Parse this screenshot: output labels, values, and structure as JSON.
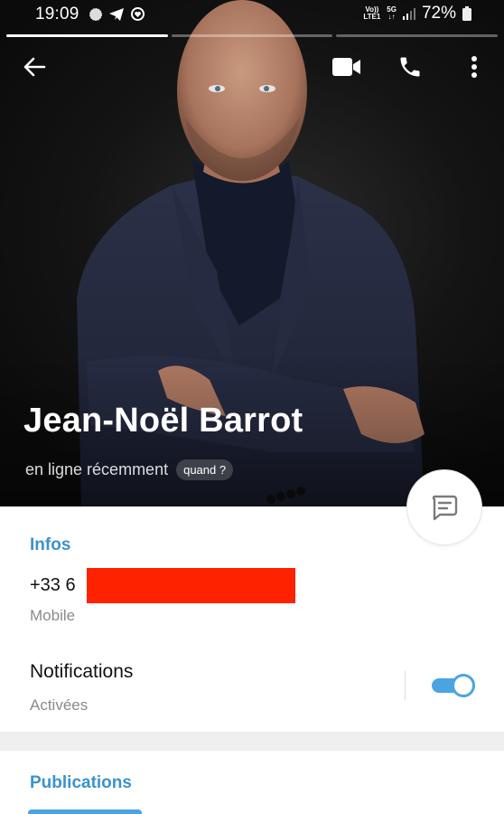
{
  "status_bar": {
    "time": "19:09",
    "left_icons": [
      "signal-app-icon",
      "telegram-icon",
      "screen-record-icon"
    ],
    "lte_line1": "Vo))",
    "lte_line2": "LTE1",
    "network": "5G",
    "network_arrows": "↓↑",
    "battery_percent": "72%"
  },
  "stories": {
    "count": 3,
    "active_index": 0
  },
  "toolbar": {
    "back_icon": "arrow-left-icon",
    "video_call_icon": "video-camera-icon",
    "call_icon": "phone-icon",
    "more_icon": "more-vertical-icon"
  },
  "profile": {
    "name": "Jean-Noël Barrot",
    "status": "en ligne récemment",
    "status_chip": "quand ?",
    "message_button_icon": "message-icon"
  },
  "info": {
    "section_title": "Infos",
    "phone_prefix": "+33 6",
    "phone_redacted": true,
    "phone_label": "Mobile",
    "notifications_title": "Notifications",
    "notifications_status": "Activées",
    "notifications_enabled": true
  },
  "publications": {
    "section_title": "Publications"
  },
  "colors": {
    "accent": "#3b93cb",
    "toggle": "#4aa4e2",
    "redaction": "#ff2200"
  }
}
